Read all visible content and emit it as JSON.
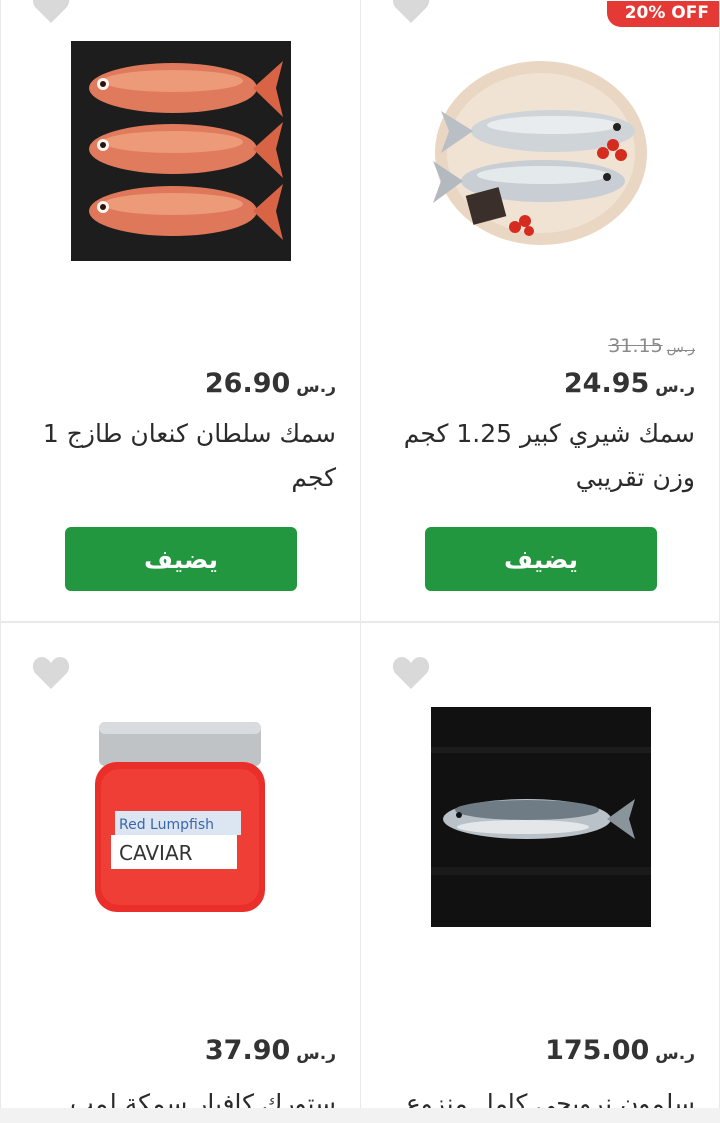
{
  "currency": "ر.س",
  "products": [
    {
      "id_key": "sultan",
      "title": "سمك سلطان كنعان طازج 1 كجم",
      "price": "26.90",
      "old_price": null,
      "discount_badge": null,
      "button_label": "يضيف",
      "image_icon": "red-fish-photo"
    },
    {
      "id_key": "shiri",
      "title": "سمك شيري كبير 1.25 كجم وزن تقريبي",
      "price": "24.95",
      "old_price": "31.15",
      "discount_badge": "20% OFF",
      "button_label": "يضيف",
      "image_icon": "white-fish-platter-photo"
    },
    {
      "id_key": "caviar",
      "title": "ستورك كافيار سمكة لمب",
      "price": "37.90",
      "old_price": null,
      "discount_badge": null,
      "image_icon": "caviar-jar-photo",
      "jar_label_top": "Red Lumpfish",
      "jar_label_bottom": "CAVIAR"
    },
    {
      "id_key": "salmon",
      "title": "سلمون نرويجي كامل منزوع",
      "price": "175.00",
      "old_price": null,
      "discount_badge": null,
      "image_icon": "salmon-photo"
    }
  ],
  "colors": {
    "add_button": "#22973f",
    "badge": "#e53935",
    "favorite_icon": "#d9d9d9"
  }
}
